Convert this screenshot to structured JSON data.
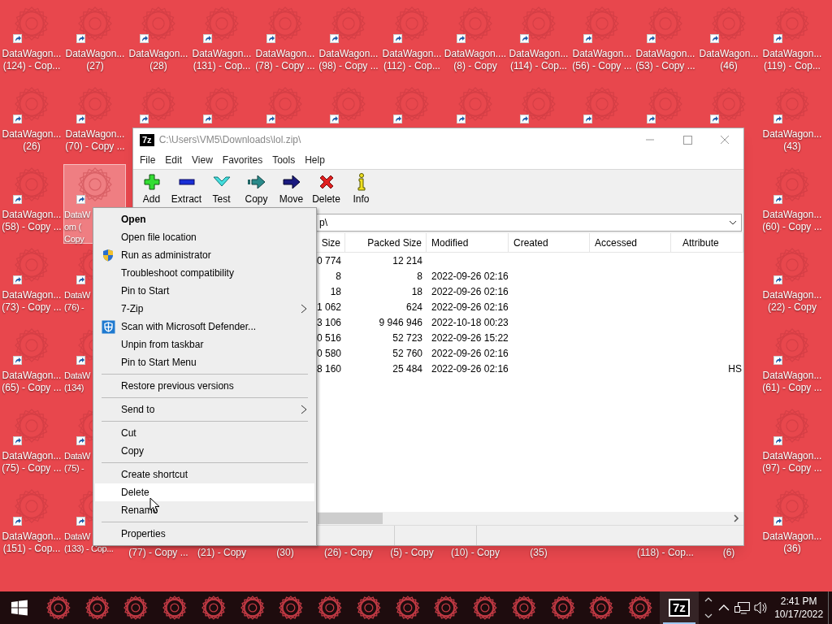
{
  "desktop": {
    "icons": [
      {
        "label": "DataWagon...\n(124) - Cop...",
        "selected": false
      },
      {
        "label": "DataWagon...\n(27)",
        "selected": false
      },
      {
        "label": "DataWagon...\n(28)",
        "selected": false
      },
      {
        "label": "DataWagon...\n(131) - Cop...",
        "selected": false
      },
      {
        "label": "DataWagon...\n(78) - Copy ...",
        "selected": false
      },
      {
        "label": "DataWagon...\n(98) - Copy ...",
        "selected": false
      },
      {
        "label": "DataWagon...\n(112) - Cop...",
        "selected": false
      },
      {
        "label": "DataWagon....\n(8) - Copy",
        "selected": false
      },
      {
        "label": "DataWagon...\n(114) - Cop...",
        "selected": false
      },
      {
        "label": "DataWagon...\n(56) - Copy ...",
        "selected": false
      },
      {
        "label": "DataWagon...\n(53) - Copy ...",
        "selected": false
      },
      {
        "label": "DataWagon...\n(46)",
        "selected": false
      },
      {
        "label": "DataWagon...\n(119) - Cop...",
        "selected": false
      },
      {
        "label": "DataWagon...\n(26)",
        "selected": false
      },
      {
        "label": "DataWagon...\n(70) - Copy ...",
        "selected": false
      },
      {
        "selected": false
      },
      {
        "selected": false
      },
      {
        "selected": false
      },
      {
        "selected": false
      },
      {
        "selected": false
      },
      {
        "selected": false
      },
      {
        "selected": false
      },
      {
        "selected": false
      },
      {
        "selected": false
      },
      {
        "selected": false
      },
      {
        "label": "DataWagon...\n(43)",
        "selected": false
      },
      {
        "label": "DataWagon...\n(58) - Copy ...",
        "selected": false
      },
      {
        "label": "DataW\nom (\nCopy",
        "selected": true,
        "cut_right": true
      },
      {
        "label": "DataWagon...\n(60) - Copy ...",
        "selected": false
      },
      {
        "label": "DataWagon...\n(73) - Copy ...",
        "selected": false
      },
      {
        "label": "DataW\n(76) -",
        "selected": false,
        "cut_right": true
      },
      {
        "label": "DataWagon...\n(22) - Copy",
        "selected": false
      },
      {
        "label": "DataWagon...\n(65) - Copy ...",
        "selected": false
      },
      {
        "label": "DataW\n(134)",
        "selected": false,
        "cut_right": true
      },
      {
        "label": "DataWagon...\n(61) - Copy ...",
        "selected": false
      },
      {
        "label": "DataWagon...\n(75) - Copy ...",
        "selected": false
      },
      {
        "label": "DataW\n(75) -",
        "selected": false,
        "cut_right": true
      },
      {
        "label": "DataWagon...\n(97) - Copy ...",
        "selected": false
      },
      {
        "label": "DataWagon...\n(151) - Cop...",
        "selected": false
      },
      {
        "label": "DataW\n(133) - Cop...",
        "selected": false,
        "cut_right": true
      },
      {
        "label": "(77) - Copy ...",
        "selected": false,
        "first_line_hidden": true
      },
      {
        "label": "(21) - Copy",
        "selected": false,
        "first_line_hidden": true
      },
      {
        "label": "(30)",
        "selected": false,
        "first_line_hidden": true
      },
      {
        "label": "(26) - Copy",
        "selected": false,
        "first_line_hidden": true
      },
      {
        "label": "(5) - Copy",
        "selected": false,
        "first_line_hidden": true
      },
      {
        "label": "(10) - Copy",
        "selected": false,
        "first_line_hidden": true
      },
      {
        "label": "(35)",
        "selected": false,
        "first_line_hidden": true
      },
      {
        "label": "(118) - Cop...",
        "selected": false,
        "first_line_hidden": true
      },
      {
        "label": "(6)",
        "selected": false,
        "first_line_hidden": true
      },
      {
        "label": "DataWagon...\n(36)",
        "selected": false
      }
    ]
  },
  "archive_window": {
    "logo": "7z",
    "title": "C:\\Users\\VM5\\Downloads\\lol.zip\\",
    "active": false,
    "menu": [
      "File",
      "Edit",
      "View",
      "Favorites",
      "Tools",
      "Help"
    ],
    "toolbar": [
      {
        "kind": "add",
        "label": "Add"
      },
      {
        "kind": "extract",
        "label": "Extract"
      },
      {
        "kind": "test",
        "label": "Test"
      },
      {
        "kind": "copy",
        "label": "Copy"
      },
      {
        "kind": "move",
        "label": "Move"
      },
      {
        "kind": "delete",
        "label": "Delete"
      },
      {
        "kind": "info",
        "label": "Info"
      }
    ],
    "path": "p\\",
    "columns": [
      "Size",
      "Packed Size",
      "Modified",
      "Created",
      "Accessed",
      "Attribute"
    ],
    "rows": [
      {
        "size": "0 774",
        "packed_size": "12 214"
      },
      {
        "size": "8",
        "packed_size": "8",
        "modified": "2022-09-26 02:16"
      },
      {
        "size": "18",
        "packed_size": "18",
        "modified": "2022-09-26 02:16"
      },
      {
        "size": "1 062",
        "packed_size": "624",
        "modified": "2022-09-26 02:16"
      },
      {
        "size": "3 106",
        "packed_size": "9 946 946",
        "modified": "2022-10-18 00:23"
      },
      {
        "size": "0 516",
        "packed_size": "52 723",
        "modified": "2022-09-26 15:22"
      },
      {
        "size": "0 580",
        "packed_size": "52 760",
        "modified": "2022-09-26 02:16"
      },
      {
        "size": "8 160",
        "packed_size": "25 484",
        "modified": "2022-09-26 02:16",
        "attribute": "HS"
      }
    ]
  },
  "context_menu": {
    "items": [
      {
        "kind": "item",
        "label": "Open",
        "default": true,
        "highlighted": false
      },
      {
        "kind": "item",
        "label": "Open file location",
        "highlighted": false
      },
      {
        "kind": "admin_item",
        "label": "Run as administrator",
        "highlighted": false
      },
      {
        "kind": "item",
        "label": "Troubleshoot compatibility",
        "highlighted": false
      },
      {
        "kind": "item",
        "label": "Pin to Start",
        "highlighted": false
      },
      {
        "kind": "item",
        "label": "7-Zip",
        "submenu": true,
        "highlighted": false
      },
      {
        "kind": "scan_item",
        "label": "Scan with Microsoft Defender...",
        "highlighted": false
      },
      {
        "kind": "item",
        "label": "Unpin from taskbar",
        "highlighted": false
      },
      {
        "kind": "item",
        "label": "Pin to Start Menu",
        "highlighted": false
      },
      {
        "kind": "separator"
      },
      {
        "kind": "item",
        "label": "Restore previous versions",
        "highlighted": false
      },
      {
        "kind": "separator"
      },
      {
        "kind": "item",
        "label": "Send to",
        "submenu": true,
        "highlighted": false
      },
      {
        "kind": "separator"
      },
      {
        "kind": "item",
        "label": "Cut",
        "highlighted": false
      },
      {
        "kind": "item",
        "label": "Copy",
        "highlighted": false
      },
      {
        "kind": "separator"
      },
      {
        "kind": "item",
        "label": "Create shortcut",
        "highlighted": false
      },
      {
        "kind": "item",
        "label": "Delete",
        "highlighted": true
      },
      {
        "kind": "item",
        "label": "Rename",
        "highlighted": false
      },
      {
        "kind": "separator"
      },
      {
        "kind": "item",
        "label": "Properties",
        "highlighted": false
      }
    ]
  },
  "taskbar": {
    "running_app": {
      "logo": "7z",
      "active": true
    },
    "time": "2:41 PM",
    "date": "10/17/2022"
  }
}
